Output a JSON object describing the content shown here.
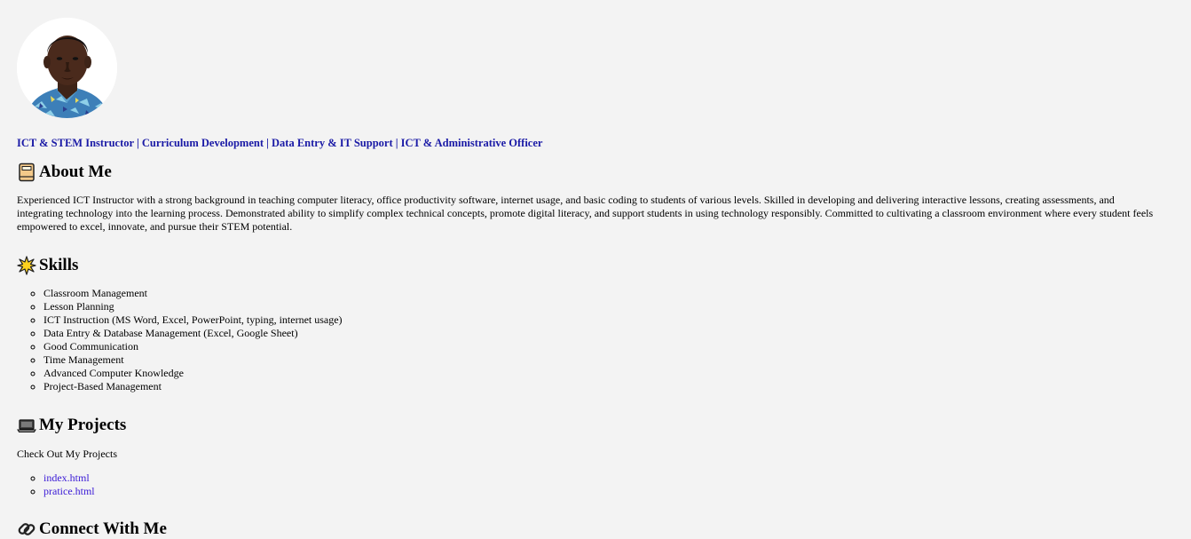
{
  "profile": {
    "avatar_icon": "person-portrait",
    "tagline": {
      "items": [
        "ICT & STEM Instructor",
        "Curriculum Development",
        "Data Entry & IT Support",
        "ICT & Administrative Officer"
      ],
      "separator": " | "
    }
  },
  "about": {
    "heading": "About Me",
    "icon": "notebook-icon",
    "text": "Experienced ICT Instructor with a strong background in teaching computer literacy, office productivity software, internet usage, and basic coding to students of various levels. Skilled in developing and delivering interactive lessons, creating assessments, and integrating technology into the learning process. Demonstrated ability to simplify complex technical concepts, promote digital literacy, and support students in using technology responsibly. Committed to cultivating a classroom environment where every student feels empowered to excel, innovate, and pursue their STEM potential."
  },
  "skills": {
    "heading": "Skills",
    "icon": "sparkle-icon",
    "items": [
      "Classroom Management",
      "Lesson Planning",
      "ICT Instruction (MS Word, Excel, PowerPoint, typing, internet usage)",
      "Data Entry & Database Management (Excel, Google Sheet)",
      "Good Communication",
      "Time Management",
      "Advanced Computer Knowledge",
      "Project-Based Management"
    ]
  },
  "projects": {
    "heading": "My Projects",
    "icon": "laptop-icon",
    "intro": "Check Out My Projects",
    "links": [
      "index.html",
      "pratice.html"
    ]
  },
  "connect": {
    "heading": "Connect With Me",
    "icon": "link-icon"
  },
  "colors": {
    "background": "#f3f3f3",
    "tagline": "#1a1aa6",
    "link": "#3a1ad6"
  }
}
